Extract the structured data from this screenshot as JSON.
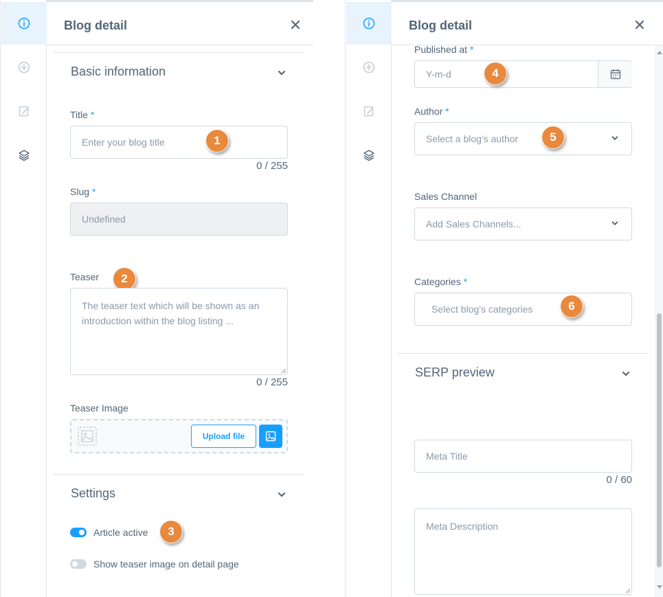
{
  "header": {
    "title": "Blog detail"
  },
  "left": {
    "basic_info_title": "Basic information",
    "title_label": "Title",
    "title_placeholder": "Enter your blog title",
    "title_counter": "0 / 255",
    "slug_label": "Slug",
    "slug_value": "Undefined",
    "teaser_label": "Teaser",
    "teaser_placeholder": "The teaser text which will be shown as an introduction within the blog listing ...",
    "teaser_counter": "0 / 255",
    "teaser_image_label": "Teaser Image",
    "upload_label": "Upload file",
    "settings_title": "Settings",
    "article_active_label": "Article active",
    "article_active": true,
    "show_teaser_label": "Show teaser image on detail page",
    "show_teaser": false
  },
  "right": {
    "published_label": "Published at",
    "published_placeholder": "Y-m-d",
    "author_label": "Author",
    "author_placeholder": "Select a blog's author",
    "sales_channel_label": "Sales Channel",
    "sales_channel_placeholder": "Add Sales Channels...",
    "categories_label": "Categories",
    "categories_placeholder": "Select blog's categories",
    "serp_title": "SERP preview",
    "meta_title_placeholder": "Meta Title",
    "meta_title_counter": "0 / 60",
    "meta_description_placeholder": "Meta Description"
  },
  "required_mark": "*",
  "badges": [
    "1",
    "2",
    "3",
    "4",
    "5",
    "6"
  ],
  "icons": {
    "rail": [
      "info-icon",
      "plus-circle-icon",
      "edit-icon",
      "layers-icon"
    ],
    "close": "close-icon",
    "chevron": "chevron-down-icon",
    "calendar": "calendar-icon",
    "image": "image-icon"
  },
  "colors": {
    "accent": "#189eff",
    "badge": "#e8893d",
    "text": "#52667a",
    "muted": "#8a9aab"
  }
}
